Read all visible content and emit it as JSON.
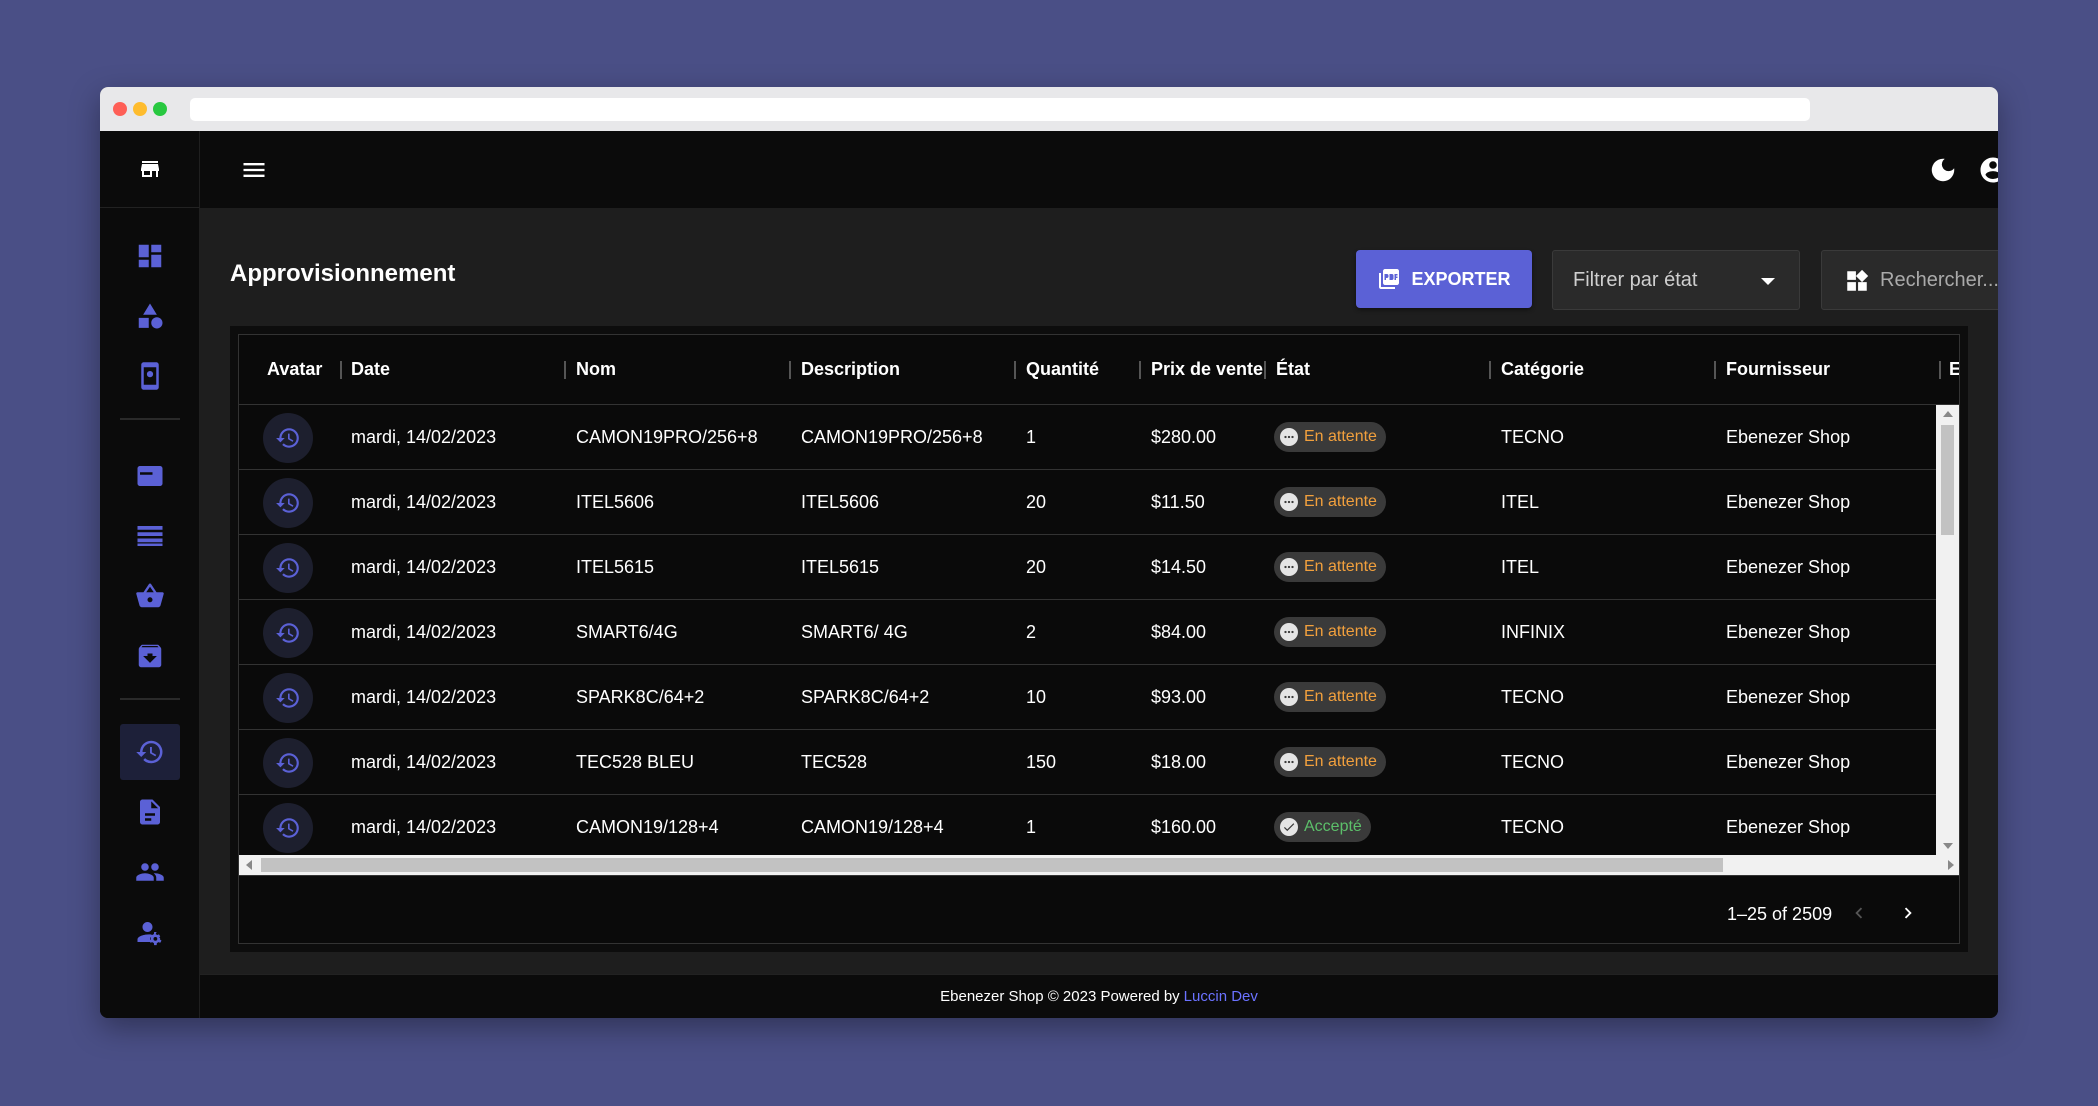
{
  "page": {
    "title": "Approvisionnement",
    "export_label": "EXPORTER",
    "filter_label": "Filtrer par état",
    "search_placeholder": "Rechercher..."
  },
  "columns": [
    "Avatar",
    "Date",
    "Nom",
    "Description",
    "Quantité",
    "Prix de vente",
    "État",
    "Catégorie",
    "Fournisseur",
    "E"
  ],
  "rows": [
    {
      "date": "mardi, 14/02/2023",
      "nom": "CAMON19PRO/256+8",
      "description": "CAMON19PRO/256+8",
      "quantite": "1",
      "prix": "$280.00",
      "etat": "En attente",
      "categorie": "TECNO",
      "fournisseur": "Ebenezer Shop"
    },
    {
      "date": "mardi, 14/02/2023",
      "nom": "ITEL5606",
      "description": "ITEL5606",
      "quantite": "20",
      "prix": "$11.50",
      "etat": "En attente",
      "categorie": "ITEL",
      "fournisseur": "Ebenezer Shop"
    },
    {
      "date": "mardi, 14/02/2023",
      "nom": "ITEL5615",
      "description": "ITEL5615",
      "quantite": "20",
      "prix": "$14.50",
      "etat": "En attente",
      "categorie": "ITEL",
      "fournisseur": "Ebenezer Shop"
    },
    {
      "date": "mardi, 14/02/2023",
      "nom": "SMART6/4G",
      "description": "SMART6/ 4G",
      "quantite": "2",
      "prix": "$84.00",
      "etat": "En attente",
      "categorie": "INFINIX",
      "fournisseur": "Ebenezer Shop"
    },
    {
      "date": "mardi, 14/02/2023",
      "nom": "SPARK8C/64+2",
      "description": "SPARK8C/64+2",
      "quantite": "10",
      "prix": "$93.00",
      "etat": "En attente",
      "categorie": "TECNO",
      "fournisseur": "Ebenezer Shop"
    },
    {
      "date": "mardi, 14/02/2023",
      "nom": "TEC528 BLEU",
      "description": "TEC528",
      "quantite": "150",
      "prix": "$18.00",
      "etat": "En attente",
      "categorie": "TECNO",
      "fournisseur": "Ebenezer Shop"
    },
    {
      "date": "mardi, 14/02/2023",
      "nom": "CAMON19/128+4",
      "description": "CAMON19/128+4",
      "quantite": "1",
      "prix": "$160.00",
      "etat": "Accepté",
      "categorie": "TECNO",
      "fournisseur": "Ebenezer Shop"
    }
  ],
  "pagination": {
    "text": "1–25 of 2509"
  },
  "footer": {
    "text": "Ebenezer Shop © 2023 Powered by",
    "link": "Luccin Dev"
  },
  "colors": {
    "accent": "#5b61d6",
    "pending": "#f2a03d",
    "accepted": "#5cbf6a",
    "background": "#4a4f86"
  },
  "icons": {
    "sidebar": [
      "dashboard-icon",
      "category-icon",
      "device-settings-icon",
      "article-icon",
      "list-icon",
      "basket-icon",
      "archive-icon",
      "history-icon",
      "document-icon",
      "people-icon",
      "user-settings-icon"
    ],
    "topbar": [
      "menu-icon",
      "dark-mode-icon",
      "account-icon",
      "fullscreen-icon"
    ]
  }
}
